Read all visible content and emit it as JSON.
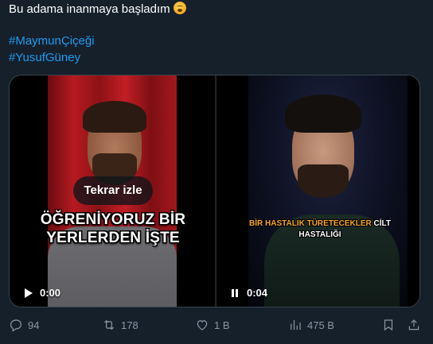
{
  "tweet": {
    "text": "Bu adama inanmaya başladım",
    "emoji": "hushed-face-emoji",
    "hashtags": [
      "#MaymunÇiçeği",
      "#YusufGüney"
    ]
  },
  "media": {
    "left_video": {
      "replay_label": "Tekrar izle",
      "caption": "ÖĞRENİYORUZ BİR YERLERDEN İŞTE",
      "time": "0:00",
      "control_icon": "play-icon"
    },
    "right_video": {
      "caption_highlight": "BİR HASTALIK TÜRETECEKLER",
      "caption_rest": " CİLT HASTALIĞI",
      "time": "0:04",
      "control_icon": "pause-icon"
    }
  },
  "actions": {
    "replies": "94",
    "reposts": "178",
    "likes": "1 B",
    "views": "475 B"
  },
  "colors": {
    "background": "#15202b",
    "link": "#1d9bf0",
    "muted": "#8b98a5",
    "caption_highlight": "#f5a623"
  }
}
